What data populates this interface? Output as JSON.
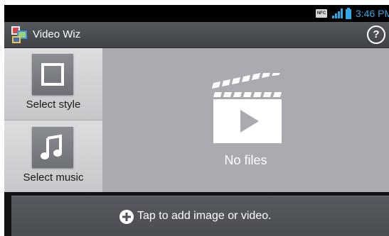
{
  "status_bar": {
    "nfc_label": "NFC",
    "time": "3:46 PM"
  },
  "action_bar": {
    "title": "Video Wiz",
    "help_label": "?"
  },
  "options": [
    {
      "label": "Select style",
      "icon": "square-frame-icon"
    },
    {
      "label": "Select music",
      "icon": "music-note-icon"
    }
  ],
  "preview": {
    "empty_label": "No files",
    "icon": "clapperboard-play-icon"
  },
  "bottom": {
    "add_label": "Tap to add image or video.",
    "icon": "plus-circle-icon"
  },
  "colors": {
    "status_time": "#2ea8e6",
    "action_bar": "#4a4d51",
    "preview_bg": "#a9abb0"
  }
}
